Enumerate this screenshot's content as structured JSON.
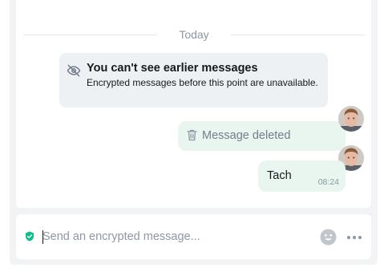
{
  "timeline": {
    "date_separator": "Today",
    "notice": {
      "title": "You can't see earlier messages",
      "description": "Encrypted messages before this point are unavailable.",
      "icon": "eye-off-icon"
    },
    "messages": [
      {
        "type": "deleted",
        "text": "Message deleted",
        "icon": "trash-icon"
      },
      {
        "type": "text",
        "text": "Tach",
        "time": "08:24"
      }
    ]
  },
  "composer": {
    "placeholder": "Send an encrypted message...",
    "value": "",
    "icons": [
      "shield-check-icon",
      "emoji-icon",
      "more-options-icon"
    ]
  },
  "colors": {
    "accent": "#0dbd8b",
    "bubble_own": "#e8f6ef",
    "notice_bg": "#eef1f4",
    "secondary_text": "#8d97a5"
  }
}
